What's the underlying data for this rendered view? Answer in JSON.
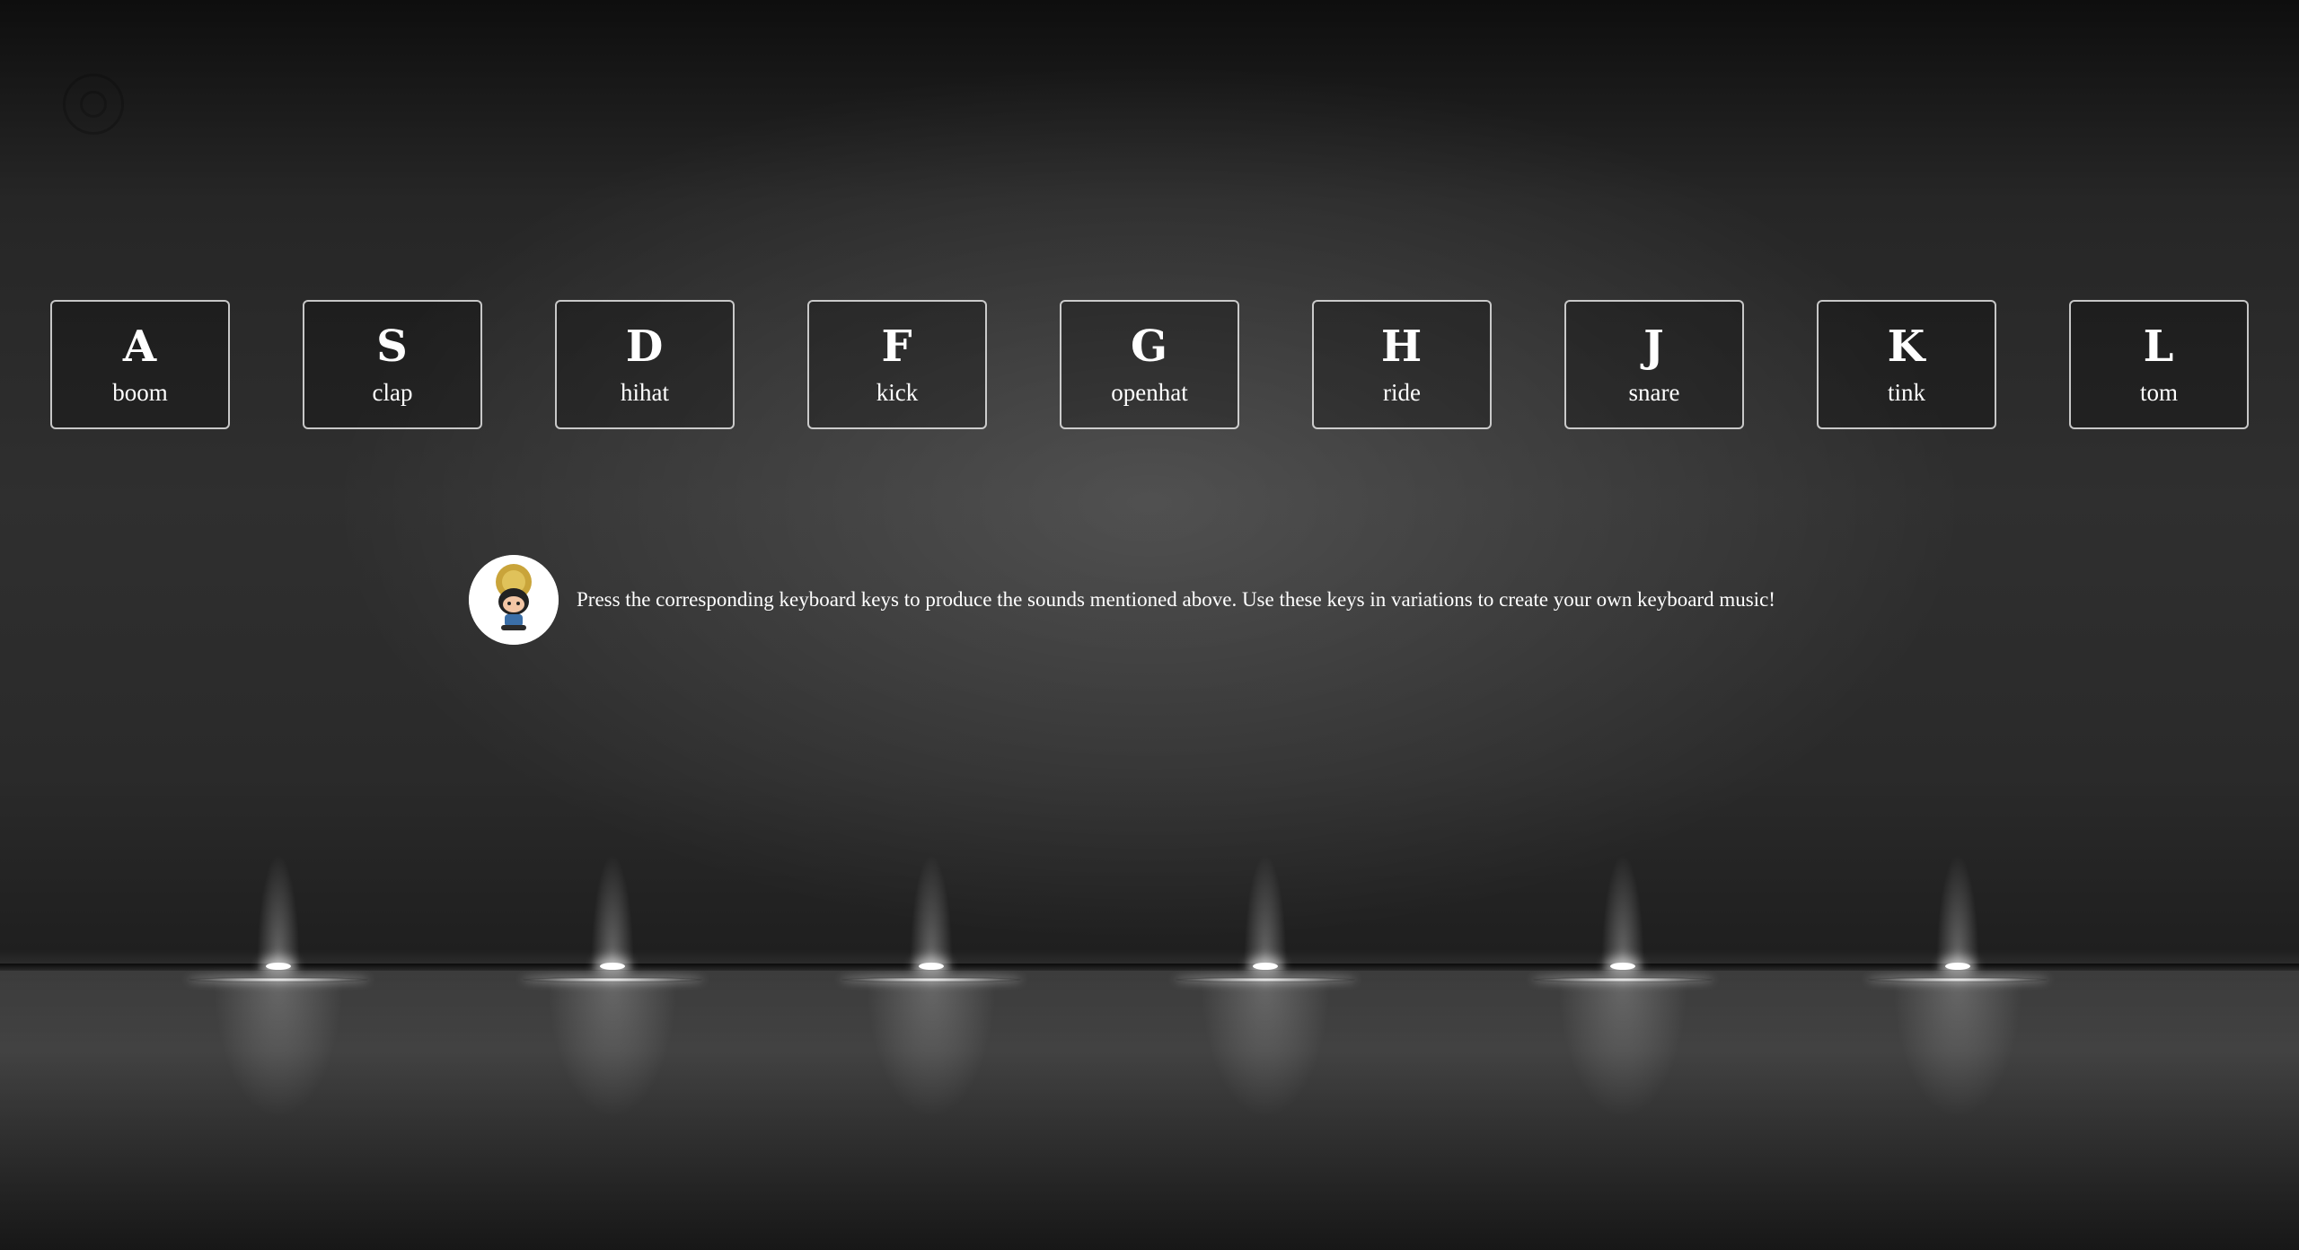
{
  "keys": [
    {
      "letter": "A",
      "sound": "boom"
    },
    {
      "letter": "S",
      "sound": "clap"
    },
    {
      "letter": "D",
      "sound": "hihat"
    },
    {
      "letter": "F",
      "sound": "kick"
    },
    {
      "letter": "G",
      "sound": "openhat"
    },
    {
      "letter": "H",
      "sound": "ride"
    },
    {
      "letter": "J",
      "sound": "snare"
    },
    {
      "letter": "K",
      "sound": "tink"
    },
    {
      "letter": "L",
      "sound": "tom"
    }
  ],
  "info": {
    "avatar_icon": "octocat-avatar",
    "text": "Press the corresponding keyboard keys to produce the sounds mentioned above. Use these keys in variations to create your own keyboard music!"
  },
  "corner_icon": "github-icon",
  "colors": {
    "key_border": "#d0d0d0",
    "text": "#ffffff",
    "background": "#2a2a2a"
  }
}
